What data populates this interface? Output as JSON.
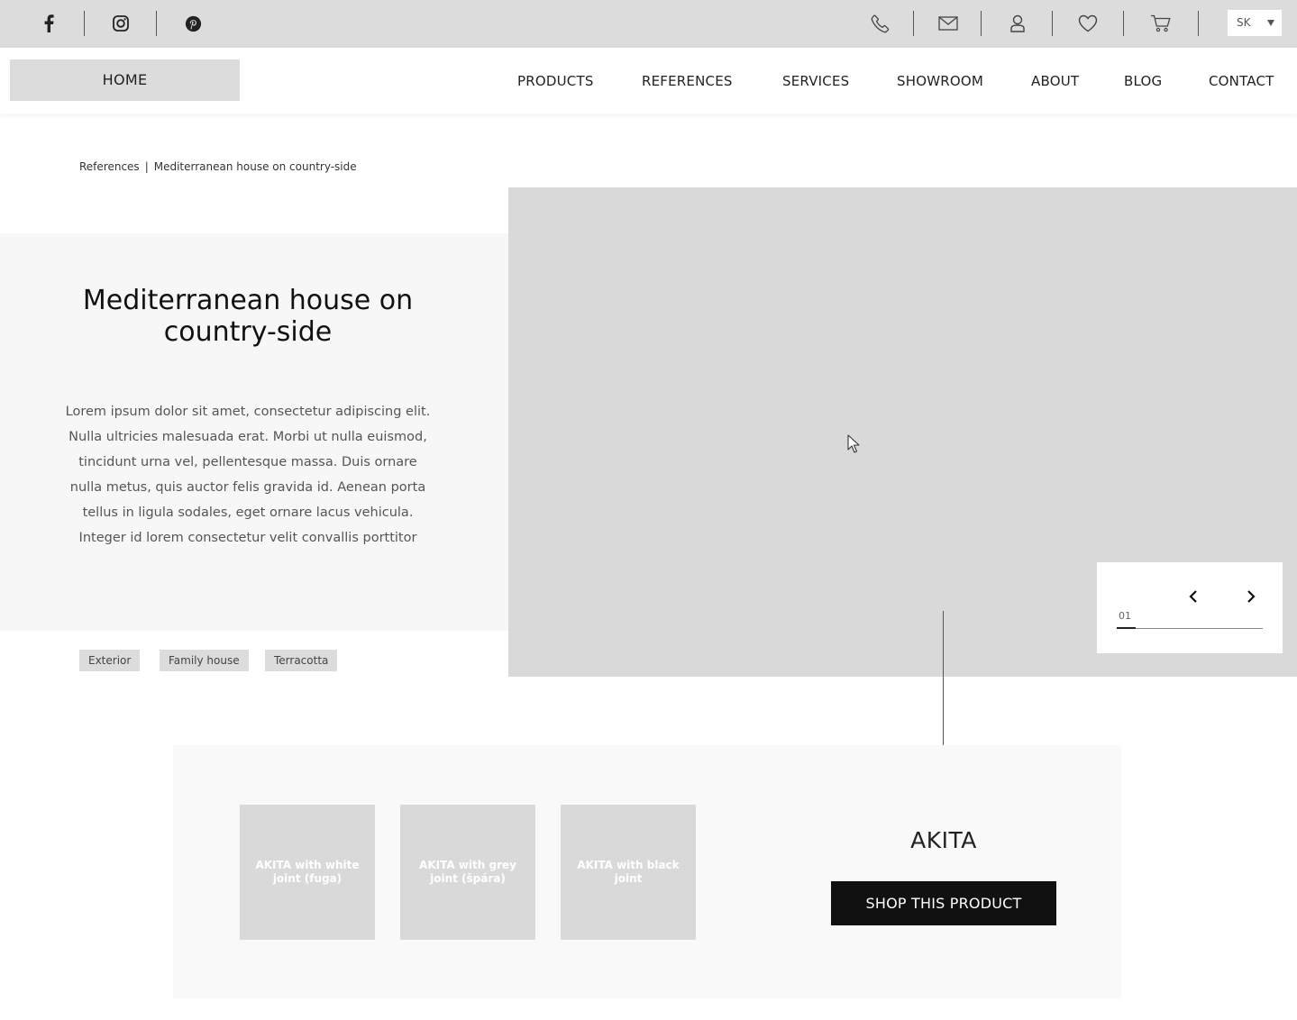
{
  "social": {
    "icons": [
      "facebook-icon",
      "instagram-icon",
      "pinterest-icon"
    ]
  },
  "topbar": {
    "icons": [
      "phone-icon",
      "mail-icon",
      "user-icon",
      "heart-icon",
      "cart-icon"
    ],
    "language": "SK"
  },
  "nav": {
    "home": "HOME",
    "items": [
      "PRODUCTS",
      "REFERENCES",
      "SERVICES",
      "SHOWROOM",
      "ABOUT",
      "BLOG",
      "CONTACT"
    ]
  },
  "breadcrumb": {
    "parent": "References",
    "separator": "|",
    "current": "Mediterranean house on country-side"
  },
  "reference": {
    "title": "Mediterranean house on country-side",
    "description": "Lorem ipsum dolor sit amet, consectetur adipiscing elit. Nulla ultricies malesuada erat. Morbi ut nulla euismod, tincidunt urna vel, pellentesque massa. Duis ornare nulla metus, quis auctor felis gravida id. Aenean porta tellus in ligula sodales, eget ornare lacus vehicula. Integer id lorem consectetur velit convallis porttitor",
    "tags": [
      "Exterior",
      "Family house",
      "Terracotta"
    ]
  },
  "gallery": {
    "counter": "01",
    "progress": 0.13
  },
  "product": {
    "name": "AKITA",
    "variants": [
      "AKITA with white joint (fuga)",
      "AKITA with grey joint (špára)",
      "AKITA with black joint"
    ],
    "cta": "SHOP THIS PRODUCT"
  },
  "colors": {
    "topbar_bg": "#dcdcdc",
    "placeholder": "#d9d9d9",
    "panel_bg": "#f7f7f7",
    "button_bg": "#111111"
  }
}
